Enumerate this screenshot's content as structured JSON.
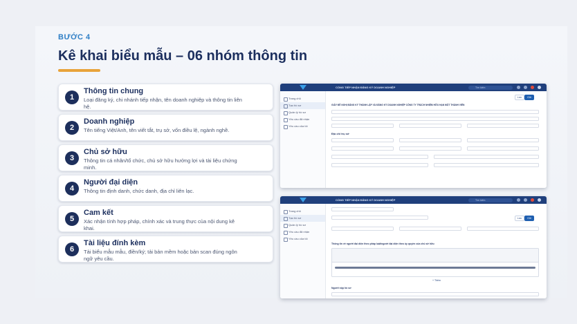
{
  "step": "BƯỚC 4",
  "title": "Kê khai biểu mẫu – 06 nhóm thông tin",
  "items": [
    {
      "num": "1",
      "title": "Thông tin chung",
      "desc": "Loại đăng ký, chi nhánh tiếp nhận, tên doanh nghiệp và thông tin liên hệ."
    },
    {
      "num": "2",
      "title": "Doanh nghiệp",
      "desc": "Tên tiếng Việt/Anh, tên viết tắt, trụ sở, vốn điều lệ, ngành nghề."
    },
    {
      "num": "3",
      "title": "Chủ sở hữu",
      "desc": "Thông tin cá nhân/tổ chức, chủ sở hữu hưởng lợi và tài liệu chứng minh."
    },
    {
      "num": "4",
      "title": "Người đại diện",
      "desc": "Thông tin định danh, chức danh, địa chỉ liên lạc."
    },
    {
      "num": "5",
      "title": "Cam kết",
      "desc": "Xác nhận tính hợp pháp, chính xác và trung thực của nội dung kê khai."
    },
    {
      "num": "6",
      "title": "Tài liệu đính kèm",
      "desc": "Tải biểu mẫu mẫu, điền/ký; tải bản mềm hoặc bản scan đúng ngôn ngữ yêu cầu."
    }
  ],
  "screens": {
    "app_name": "CỔNG TIẾP NHẬN ĐĂNG KÝ DOANH NGHIỆP",
    "search_placeholder": "Tìm kiếm",
    "side1": [
      "Trang chủ",
      "Tạo hồ sơ",
      "Quản lý hồ sơ",
      "Yêu cầu đã nhận",
      "Yêu cầu của tôi"
    ],
    "side2": [
      "Trang chủ",
      "Tạo hồ sơ",
      "Quản lý hồ sơ",
      "Yêu cầu đã nhận",
      "Yêu cầu của tôi"
    ],
    "form_title": "GIẤY ĐỀ NGHỊ ĐĂNG KÝ THÀNH LẬP VÀ ĐĂNG KÝ DOANH NGHIỆP CÔNG TY TRÁCH NHIỆM HỮU HẠN MỘT THÀNH VIÊN",
    "section_address": "Địa chỉ trụ sở",
    "section_rep": "Thông tin về người đại diện theo pháp luật/người đại diện theo ủy quyền của chủ sở hữu",
    "save_label": "Lưu",
    "submit_label": "Gửi",
    "add_label": "+ Thêm",
    "footer_label": "Người nộp hồ sơ"
  }
}
